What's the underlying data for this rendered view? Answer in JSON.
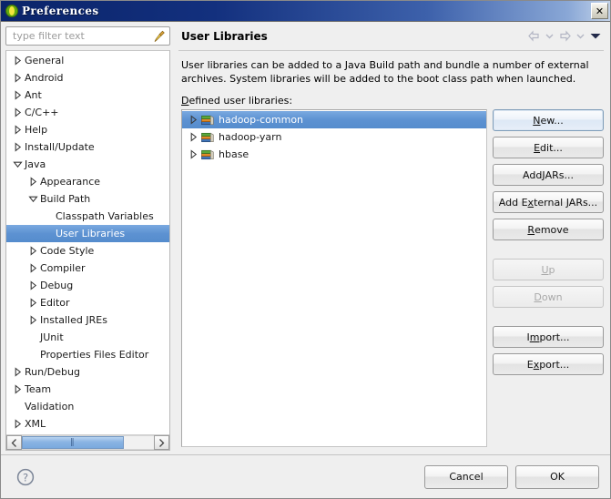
{
  "window": {
    "title": "Preferences",
    "icon": "eclipse-icon",
    "close_label": "✕"
  },
  "sidebar": {
    "filter": {
      "placeholder": "type filter text",
      "value": "",
      "clear_icon": "broom-icon"
    },
    "items": [
      {
        "label": "General",
        "indent": 0,
        "twisty": "collapsed",
        "selected": false
      },
      {
        "label": "Android",
        "indent": 0,
        "twisty": "collapsed",
        "selected": false
      },
      {
        "label": "Ant",
        "indent": 0,
        "twisty": "collapsed",
        "selected": false
      },
      {
        "label": "C/C++",
        "indent": 0,
        "twisty": "collapsed",
        "selected": false
      },
      {
        "label": "Help",
        "indent": 0,
        "twisty": "collapsed",
        "selected": false
      },
      {
        "label": "Install/Update",
        "indent": 0,
        "twisty": "collapsed",
        "selected": false
      },
      {
        "label": "Java",
        "indent": 0,
        "twisty": "expanded",
        "selected": false
      },
      {
        "label": "Appearance",
        "indent": 1,
        "twisty": "collapsed",
        "selected": false
      },
      {
        "label": "Build Path",
        "indent": 1,
        "twisty": "expanded",
        "selected": false
      },
      {
        "label": "Classpath Variables",
        "indent": 2,
        "twisty": "none",
        "selected": false
      },
      {
        "label": "User Libraries",
        "indent": 2,
        "twisty": "none",
        "selected": true
      },
      {
        "label": "Code Style",
        "indent": 1,
        "twisty": "collapsed",
        "selected": false
      },
      {
        "label": "Compiler",
        "indent": 1,
        "twisty": "collapsed",
        "selected": false
      },
      {
        "label": "Debug",
        "indent": 1,
        "twisty": "collapsed",
        "selected": false
      },
      {
        "label": "Editor",
        "indent": 1,
        "twisty": "collapsed",
        "selected": false
      },
      {
        "label": "Installed JREs",
        "indent": 1,
        "twisty": "collapsed",
        "selected": false
      },
      {
        "label": "JUnit",
        "indent": 1,
        "twisty": "none",
        "selected": false
      },
      {
        "label": "Properties Files Editor",
        "indent": 1,
        "twisty": "none",
        "selected": false
      },
      {
        "label": "Run/Debug",
        "indent": 0,
        "twisty": "collapsed",
        "selected": false
      },
      {
        "label": "Team",
        "indent": 0,
        "twisty": "collapsed",
        "selected": false
      },
      {
        "label": "Validation",
        "indent": 0,
        "twisty": "none",
        "selected": false
      },
      {
        "label": "XML",
        "indent": 0,
        "twisty": "collapsed",
        "selected": false
      }
    ],
    "scrollbar": {
      "left_arrow": "‹",
      "right_arrow": "›",
      "grip": "‖"
    }
  },
  "page": {
    "title": "User Libraries",
    "nav": {
      "back_icon": "arrow-left-icon",
      "back_menu_icon": "chevron-down-icon",
      "forward_icon": "arrow-right-icon",
      "forward_menu_icon": "chevron-down-icon",
      "menu_icon": "chevron-down-filled-icon"
    },
    "description": "User libraries can be added to a Java Build path and bundle a number of external archives. System libraries will be added to the boot class path when launched.",
    "list_label_mnemonic": "D",
    "list_label_rest": "efined user libraries:",
    "libraries": [
      {
        "name": "hadoop-common",
        "icon": "library-books-icon",
        "twisty": "collapsed",
        "selected": true
      },
      {
        "name": "hadoop-yarn",
        "icon": "library-books-icon",
        "twisty": "collapsed",
        "selected": false
      },
      {
        "name": "hbase",
        "icon": "library-books-icon",
        "twisty": "collapsed",
        "selected": false
      }
    ],
    "buttons": [
      {
        "pre": "",
        "mnemonic": "N",
        "post": "ew...",
        "state": "default"
      },
      {
        "pre": "",
        "mnemonic": "E",
        "post": "dit...",
        "state": "enabled"
      },
      {
        "pre": "Add ",
        "mnemonic": "J",
        "post": "ARs...",
        "state": "enabled"
      },
      {
        "pre": "Add E",
        "mnemonic": "x",
        "post": "ternal JARs...",
        "state": "enabled"
      },
      {
        "pre": "",
        "mnemonic": "R",
        "post": "emove",
        "state": "enabled"
      },
      {
        "pre": "",
        "mnemonic": "U",
        "post": "p",
        "state": "disabled",
        "gap_before": true
      },
      {
        "pre": "",
        "mnemonic": "D",
        "post": "own",
        "state": "disabled"
      },
      {
        "pre": "I",
        "mnemonic": "m",
        "post": "port...",
        "state": "enabled",
        "gap_before": true
      },
      {
        "pre": "E",
        "mnemonic": "x",
        "post": "port...",
        "state": "enabled"
      }
    ]
  },
  "footer": {
    "help_icon": "help-question-icon",
    "cancel_label": "Cancel",
    "ok_label": "OK"
  },
  "colors": {
    "selection_blue": "#5d92d2",
    "title_blue": "#0a246a",
    "panel_gray": "#efefef",
    "list_white": "#ffffff"
  }
}
